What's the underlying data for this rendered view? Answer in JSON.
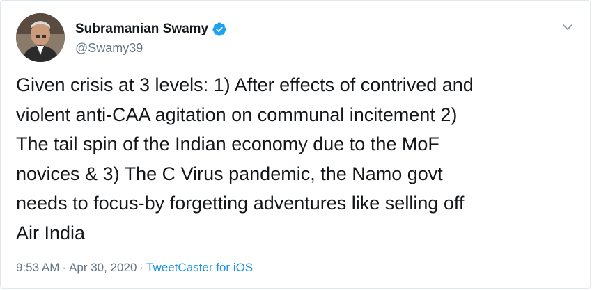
{
  "author": {
    "name": "Subramanian Swamy",
    "handle": "@Swamy39",
    "verified": true
  },
  "tweet": {
    "text": "Given crisis at 3 levels: 1) After effects of contrived and\nviolent anti-CAA agitation on communal incitement 2)\nThe tail spin of the Indian economy due to the MoF\nnovices & 3) The C Virus pandemic, the Namo govt\nneeds to focus-by forgetting adventures like selling off\nAir India"
  },
  "meta": {
    "time": "9:53 AM",
    "separator": "·",
    "date": "Apr 30, 2020",
    "source": "TweetCaster for iOS"
  },
  "colors": {
    "verified": "#1da1f2",
    "link": "#1b95e0",
    "muted": "#657786",
    "text": "#14171a"
  },
  "icons": {
    "verified": "verified-badge-icon",
    "caret": "chevron-down-icon"
  }
}
